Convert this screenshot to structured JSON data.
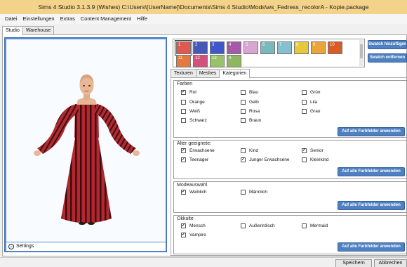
{
  "window": {
    "title": "Sims 4 Studio 3.1.3.9 (Wishes)  C:\\Users\\[UserName]\\Documents\\Sims 4 Studio\\Mods\\ws_Fedress_recolorA - Kopie.package"
  },
  "menu": [
    "Datei",
    "Einstellungen",
    "Extras",
    "Content Management",
    "Hilfe"
  ],
  "main_tabs": [
    "Studio",
    "Warehouse"
  ],
  "viewport": {
    "settings_label": "Settings"
  },
  "swatches": [
    {
      "label": "1",
      "color": "#e0584f"
    },
    {
      "label": "2",
      "color": "#4659b6"
    },
    {
      "label": "3",
      "color": "#3f57c8"
    },
    {
      "label": "4",
      "color": "#a45aa8"
    },
    {
      "label": "5",
      "color": "#d9a6d4"
    },
    {
      "label": "6",
      "color": "#7ab7bf"
    },
    {
      "label": "7",
      "color": "#86c0cf"
    },
    {
      "label": "8",
      "color": "#e6c93b"
    },
    {
      "label": "9",
      "color": "#eaa43a"
    },
    {
      "label": "10",
      "color": "#d95b26"
    },
    {
      "label": "11",
      "color": "#e57a3e"
    },
    {
      "label": "12",
      "color": "#d1527c"
    },
    {
      "label": "13",
      "color": "#97c269"
    },
    {
      "label": "4",
      "color": "#8eb75f"
    }
  ],
  "swatch_buttons": {
    "add": "Swatch hinzufügen",
    "remove": "Swatch entfernen"
  },
  "sub_tabs": [
    "Texturen",
    "Meshes",
    "Kategorien"
  ],
  "apply_label": "Auf alle Farbfelder anwenden",
  "groups": {
    "farben": {
      "title": "Farben",
      "items": [
        {
          "label": "Rot",
          "checked": true
        },
        {
          "label": "Blau",
          "checked": false
        },
        {
          "label": "Grün",
          "checked": false
        },
        {
          "label": "Orange",
          "checked": false
        },
        {
          "label": "Gelb",
          "checked": false
        },
        {
          "label": "Lila",
          "checked": false
        },
        {
          "label": "Weiß",
          "checked": false
        },
        {
          "label": "Rosa",
          "checked": false
        },
        {
          "label": "Grau",
          "checked": false
        },
        {
          "label": "Schwarz",
          "checked": false
        },
        {
          "label": "Braun",
          "checked": false
        }
      ]
    },
    "alter": {
      "title": "Alter geeignete:",
      "items": [
        {
          "label": "Erwachsene",
          "checked": true
        },
        {
          "label": "Kind",
          "checked": false
        },
        {
          "label": "Senior",
          "checked": true
        },
        {
          "label": "Teenager",
          "checked": true
        },
        {
          "label": "Junger Erwachsene",
          "checked": true
        },
        {
          "label": "Kleinkind",
          "checked": false
        }
      ]
    },
    "mode": {
      "title": "Modeauswahl",
      "items": [
        {
          "label": "Weiblich",
          "checked": true
        },
        {
          "label": "Männlich",
          "checked": false
        }
      ]
    },
    "okkulte": {
      "title": "Okkulte",
      "items": [
        {
          "label": "Mensch",
          "checked": true
        },
        {
          "label": "Außerirdisch",
          "checked": false
        },
        {
          "label": "Mermaid",
          "checked": false
        },
        {
          "label": "Vampire",
          "checked": true
        }
      ]
    }
  },
  "footer": {
    "save": "Speichern",
    "cancel": "Abbrechen"
  }
}
